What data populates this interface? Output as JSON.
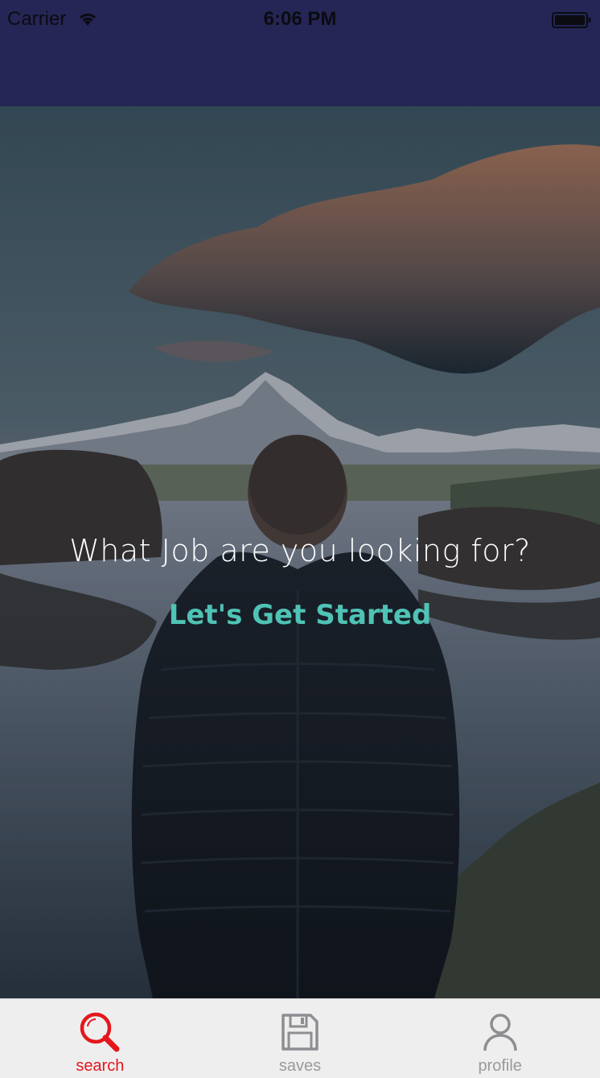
{
  "status_bar": {
    "carrier": "Carrier",
    "time": "6:06 PM"
  },
  "hero": {
    "question": "What Job are you looking for?",
    "cta_label": "Let's Get Started"
  },
  "tab_bar": {
    "active_color": "#e4171c",
    "inactive_color": "#9a9a9d",
    "tabs": [
      {
        "label": "search",
        "icon": "search-icon",
        "active": true
      },
      {
        "label": "saves",
        "icon": "floppy-disk-icon",
        "active": false
      },
      {
        "label": "profile",
        "icon": "user-icon",
        "active": false
      }
    ]
  },
  "colors": {
    "nav_background": "#252655",
    "cta": "#4fc3b5"
  }
}
